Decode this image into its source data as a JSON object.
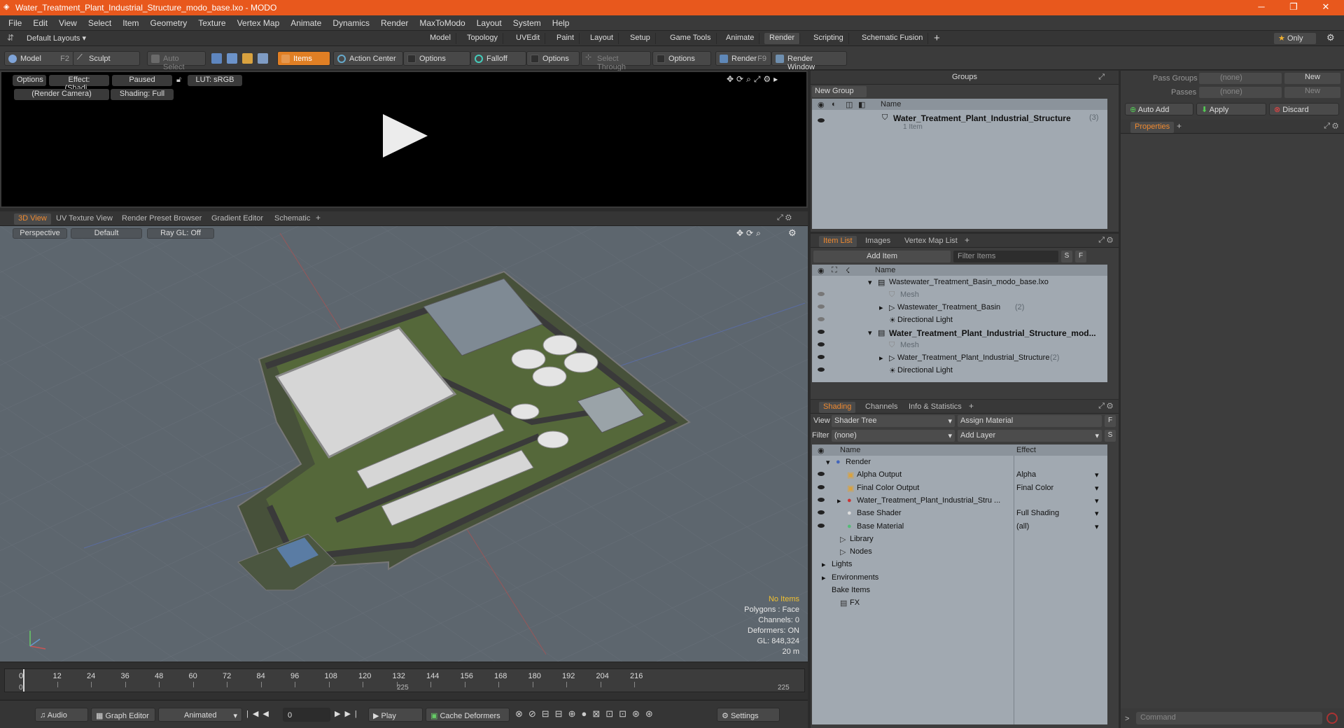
{
  "window": {
    "title": "Water_Treatment_Plant_Industrial_Structure_modo_base.lxo - MODO",
    "controls": [
      "─",
      "❐",
      "✕"
    ]
  },
  "menu": [
    "File",
    "Edit",
    "View",
    "Select",
    "Item",
    "Geometry",
    "Texture",
    "Vertex Map",
    "Animate",
    "Dynamics",
    "Render",
    "MaxToModo",
    "Layout",
    "System",
    "Help"
  ],
  "layouts": {
    "dropdown": "Default Layouts",
    "tabs": [
      "Model",
      "Topology",
      "UVEdit",
      "Paint",
      "Layout",
      "Setup",
      "Game Tools",
      "Animate",
      "Render",
      "Scripting",
      "Schematic Fusion"
    ],
    "active": "Render",
    "only": "Only"
  },
  "toolbar": {
    "model": "Model",
    "model_key": "F2",
    "sculpt": "Sculpt",
    "auto_select": "Auto Select",
    "items": "Items",
    "action_center": "Action Center",
    "options1": "Options",
    "falloff": "Falloff",
    "options2": "Options",
    "select_through": "Select Through",
    "options3": "Options",
    "render": "Render",
    "render_key": "F9",
    "render_window": "Render Window"
  },
  "render_view": {
    "options": "Options",
    "effect": "Effect: (Shadi...",
    "paused": "Paused",
    "lut": "LUT: sRGB",
    "camera": "(Render Camera)",
    "shading": "Shading: Full"
  },
  "viewport_tabs": [
    "3D View",
    "UV Texture View",
    "Render Preset Browser",
    "Gradient Editor",
    "Schematic"
  ],
  "viewport_active_tab": "3D View",
  "viewport": {
    "perspective": "Perspective",
    "default": "Default",
    "raygl": "Ray GL: Off",
    "stats": {
      "no_items": "No Items",
      "polygons": "Polygons : Face",
      "channels": "Channels: 0",
      "deformers": "Deformers: ON",
      "gl": "GL: 848,324",
      "scale": "20 m"
    }
  },
  "timeline": {
    "ticks": [
      "0",
      "12",
      "24",
      "36",
      "48",
      "60",
      "72",
      "84",
      "96",
      "108",
      "120",
      "132",
      "144",
      "156",
      "168",
      "180",
      "192",
      "204",
      "216"
    ],
    "start": "0",
    "mid": "225",
    "end": "225"
  },
  "bottombar": {
    "audio": "Audio",
    "graph_editor": "Graph Editor",
    "animated": "Animated",
    "frame": "0",
    "play": "Play",
    "cache_deformers": "Cache Deformers",
    "settings": "Settings"
  },
  "groups": {
    "title": "Groups",
    "new_group": "New Group",
    "col_name": "Name",
    "item_name": "Water_Treatment_Plant_Industrial_Structure",
    "item_count": "(3)",
    "item_sub": "1 Item"
  },
  "item_list": {
    "tabs": [
      "Item List",
      "Images",
      "Vertex Map List"
    ],
    "add_item": "Add Item",
    "filter": "Filter Items",
    "s": "S",
    "f": "F",
    "col_name": "Name",
    "rows": [
      {
        "label": "Wastewater_Treatment_Basin_modo_base.lxo",
        "bold": false,
        "dim": false
      },
      {
        "label": "Mesh",
        "bold": false,
        "dim": true
      },
      {
        "label": "Wastewater_Treatment_Basin",
        "count": "(2)",
        "bold": false,
        "dim": false
      },
      {
        "label": "Directional Light",
        "bold": false,
        "dim": false
      },
      {
        "label": "Water_Treatment_Plant_Industrial_Structure_mod...",
        "bold": true,
        "dim": false
      },
      {
        "label": "Mesh",
        "bold": false,
        "dim": true
      },
      {
        "label": "Water_Treatment_Plant_Industrial_Structure",
        "count": "(2)",
        "bold": false,
        "dim": false
      },
      {
        "label": "Directional Light",
        "bold": false,
        "dim": false
      }
    ]
  },
  "shading": {
    "tabs": [
      "Shading",
      "Channels",
      "Info & Statistics"
    ],
    "view_label": "View",
    "view_value": "Shader Tree",
    "assign_material": "Assign Material",
    "filter_label": "Filter",
    "filter_value": "(none)",
    "add_layer": "Add Layer",
    "f": "F",
    "s": "S",
    "col_name": "Name",
    "col_effect": "Effect",
    "rows": [
      {
        "label": "Render",
        "effect": ""
      },
      {
        "label": "Alpha Output",
        "effect": "Alpha"
      },
      {
        "label": "Final Color Output",
        "effect": "Final Color"
      },
      {
        "label": "Water_Treatment_Plant_Industrial_Stru ...",
        "effect": ""
      },
      {
        "label": "Base Shader",
        "effect": "Full Shading"
      },
      {
        "label": "Base Material",
        "effect": "(all)"
      },
      {
        "label": "Library",
        "effect": ""
      },
      {
        "label": "Nodes",
        "effect": ""
      },
      {
        "label": "Lights",
        "effect": ""
      },
      {
        "label": "Environments",
        "effect": ""
      },
      {
        "label": "Bake Items",
        "effect": ""
      },
      {
        "label": "FX",
        "effect": ""
      }
    ]
  },
  "right": {
    "pass_groups": "Pass Groups",
    "passes": "Passes",
    "none": "(none)",
    "new": "New",
    "auto_add": "Auto Add",
    "apply": "Apply",
    "discard": "Discard",
    "properties": "Properties",
    "command": "Command"
  },
  "colors": {
    "accent": "#f08a30",
    "title_bar": "#e8581d"
  }
}
